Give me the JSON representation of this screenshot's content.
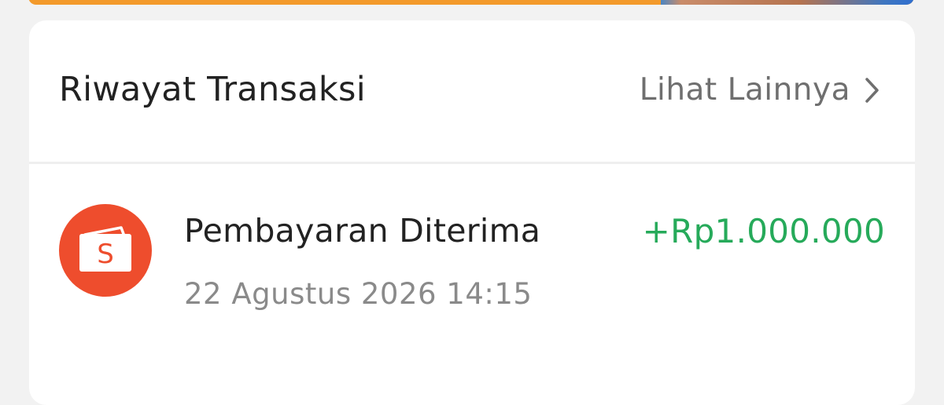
{
  "history": {
    "title": "Riwayat Transaksi",
    "see_more_label": "Lihat Lainnya",
    "see_more_icon": "chevron-right-icon"
  },
  "transactions": [
    {
      "icon": "shopeepay-wallet-icon",
      "title": "Pembayaran Diterima",
      "datetime": "22 Agustus 2026 14:15",
      "amount": "+Rp1.000.000"
    }
  ],
  "colors": {
    "accent_orange": "#ee4d2d",
    "positive_green": "#26aa5a",
    "banner_orange": "#f39a2b"
  }
}
